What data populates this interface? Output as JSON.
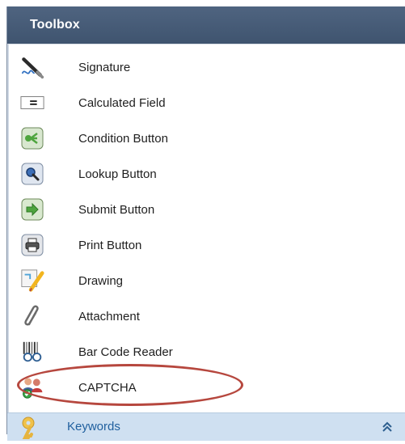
{
  "toolbox": {
    "title": "Toolbox",
    "items": [
      {
        "label": "Signature",
        "icon": "signature-pen-icon"
      },
      {
        "label": "Calculated Field",
        "icon": "calculated-field-icon"
      },
      {
        "label": "Condition Button",
        "icon": "condition-button-icon"
      },
      {
        "label": "Lookup Button",
        "icon": "lookup-button-icon"
      },
      {
        "label": "Submit Button",
        "icon": "submit-button-icon"
      },
      {
        "label": "Print Button",
        "icon": "print-button-icon"
      },
      {
        "label": "Drawing",
        "icon": "drawing-icon"
      },
      {
        "label": "Attachment",
        "icon": "paperclip-icon"
      },
      {
        "label": "Bar Code Reader",
        "icon": "barcode-reader-icon"
      },
      {
        "label": "CAPTCHA",
        "icon": "captcha-users-icon"
      }
    ]
  },
  "footer": {
    "label": "Keywords",
    "icon": "key-icon",
    "expand_icon": "double-chevron-up-icon"
  },
  "colors": {
    "header_bg": "#43586f",
    "highlight": "#b6473e",
    "footer_bg": "#cfe0f1",
    "footer_text": "#1f5f9e"
  }
}
